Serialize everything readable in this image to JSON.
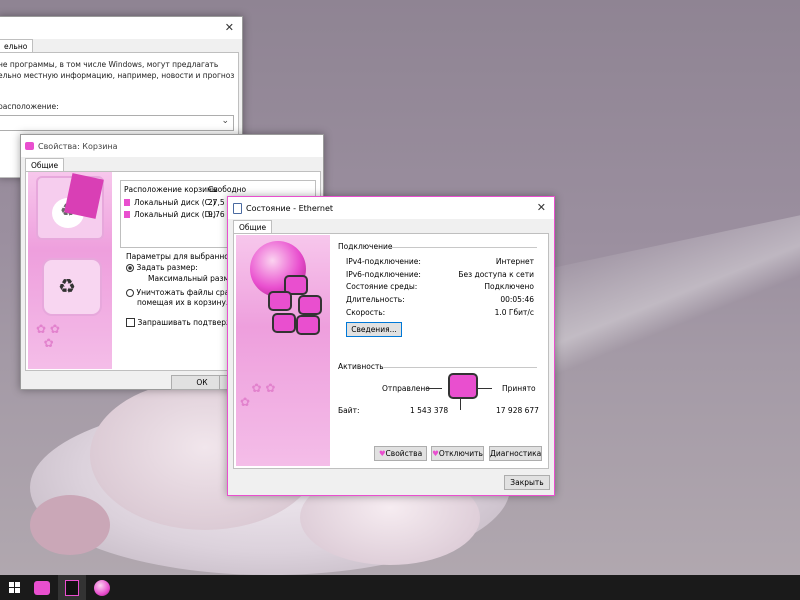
{
  "window_location": {
    "tab_label": "ельно",
    "text_line1": "не программы, в том числе Windows, могут предлагать",
    "text_line2": "ельно местную информацию, например, новости и прогноз",
    "location_label": "расположение:"
  },
  "window_recycle": {
    "title": "Свойства: Корзина",
    "tab_label": "Общие",
    "col_location": "Расположение корзины",
    "col_free": "Свободно",
    "drives": [
      {
        "name": "Локальный диск (C:)",
        "free": "27,5"
      },
      {
        "name": "Локальный диск (D:)",
        "free": "9,76"
      }
    ],
    "params_label": "Параметры для выбранного р",
    "opt_size": "Задать размер:",
    "max_size_label": "Максимальный размер (М",
    "opt_delete_line1": "Уничтожать файлы сразу п",
    "opt_delete_line2": "помещая их в корзину.",
    "confirm_label": "Запрашивать подтвержде",
    "ok_label": "ОК"
  },
  "window_ethernet": {
    "title": "Состояние - Ethernet",
    "tab_label": "Общие",
    "connection_section": "Подключение",
    "rows": [
      {
        "label": "IPv4-подключение:",
        "value": "Интернет"
      },
      {
        "label": "IPv6-подключение:",
        "value": "Без доступа к сети"
      },
      {
        "label": "Состояние среды:",
        "value": "Подключено"
      },
      {
        "label": "Длительность:",
        "value": "00:05:46"
      },
      {
        "label": "Скорость:",
        "value": "1.0 Гбит/с"
      }
    ],
    "details_button": "Сведения...",
    "activity_section": "Активность",
    "sent_label": "Отправлено",
    "received_label": "Принято",
    "bytes_label": "Байт:",
    "bytes_sent": "1 543 378",
    "bytes_received": "17 928 677",
    "properties_button": "Свойства",
    "disable_button": "Отключить",
    "diagnose_button": "Диагностика",
    "close_button": "Закрыть"
  },
  "colors": {
    "accent_pink": "#e94fcf",
    "dark_pink": "#b8127f",
    "window_bg": "#f0f0f0"
  },
  "taskbar": {
    "icons": [
      "windows-start-icon",
      "recycle-bin-icon",
      "trash-icon",
      "network-globe-icon"
    ]
  }
}
